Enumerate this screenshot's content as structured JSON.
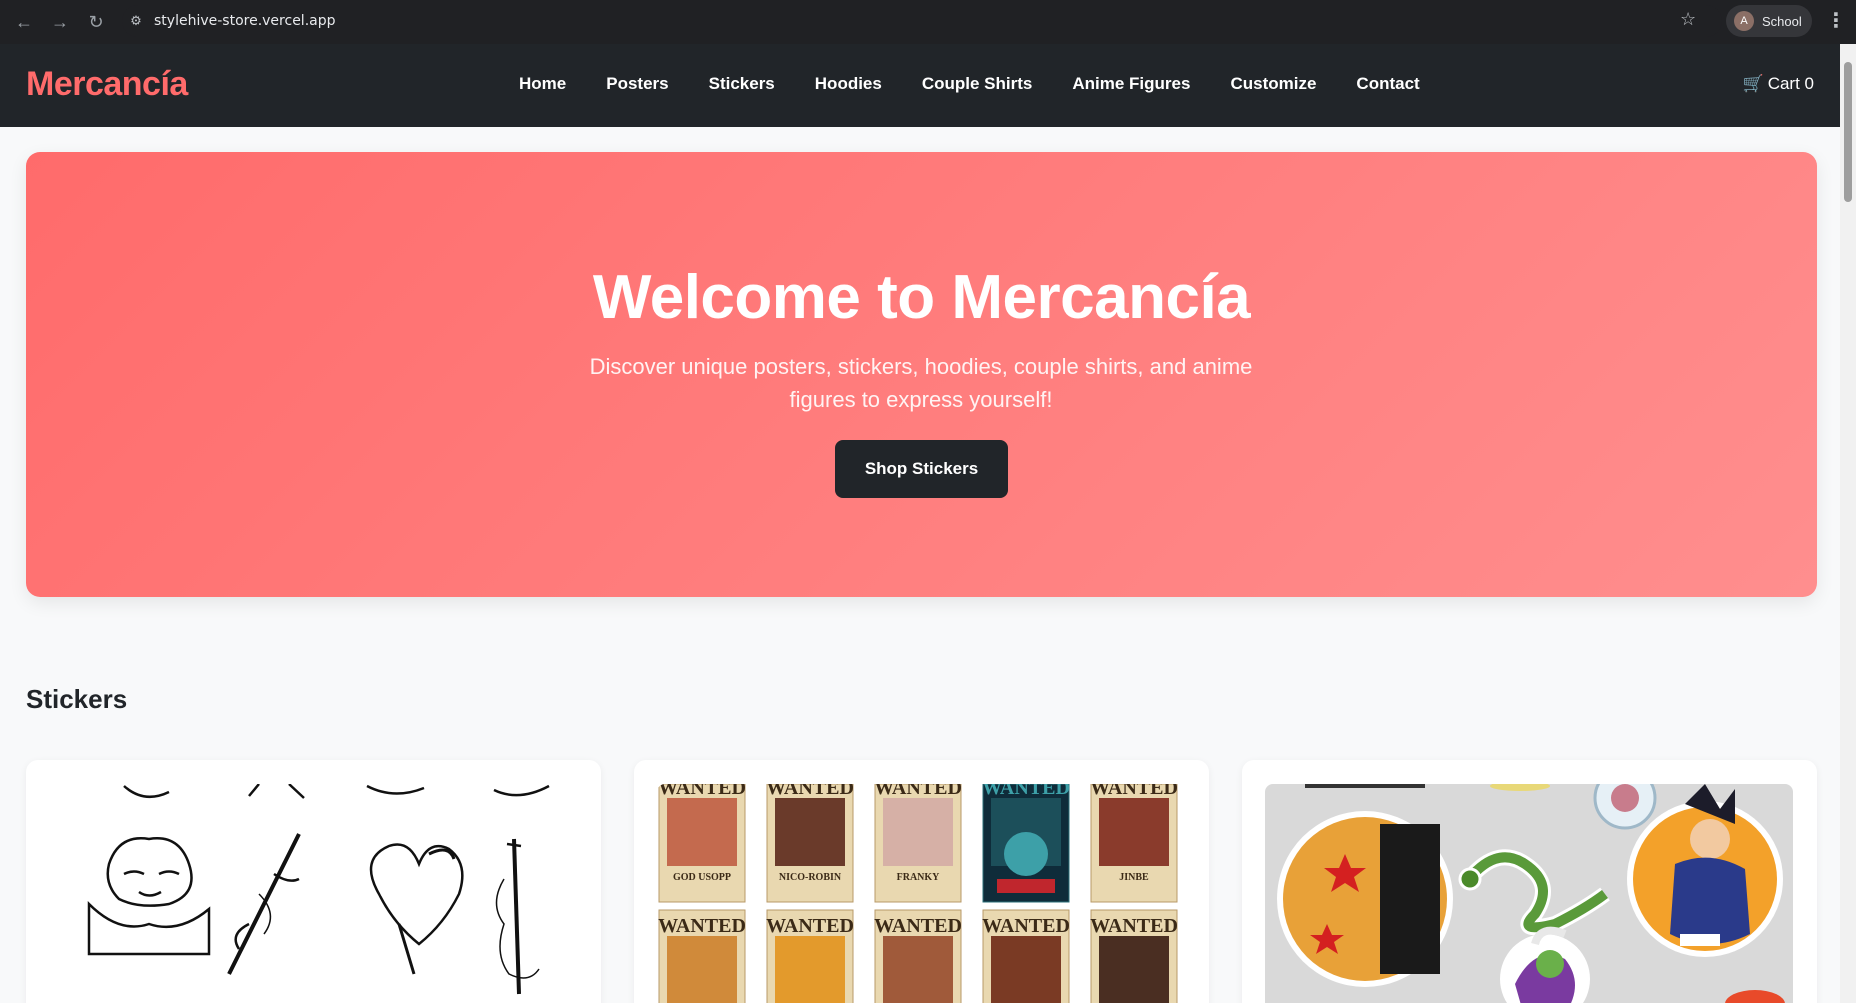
{
  "browser": {
    "url": "stylehive-store.vercel.app",
    "profile_initial": "A",
    "profile_name": "School"
  },
  "site": {
    "brand": "Mercancía",
    "brand_color": "#ff6b6b",
    "nav": [
      "Home",
      "Posters",
      "Stickers",
      "Hoodies",
      "Couple Shirts",
      "Anime Figures",
      "Customize",
      "Contact"
    ],
    "cart_icon": "🛒",
    "cart_label": "Cart 0"
  },
  "hero": {
    "title": "Welcome to Mercancía",
    "subtitle": "Discover unique posters, stickers, hoodies, couple shirts, and anime figures to express yourself!",
    "cta": "Shop Stickers"
  },
  "section": {
    "title": "Stickers",
    "wanted_labels": [
      "WANTED",
      "WANTED",
      "WANTED",
      "WANTED",
      "WANTED",
      "WANTED",
      "WANTED",
      "WANTED",
      "WANTED",
      "WANTED"
    ],
    "poster_captions": [
      "GOD USOPP",
      "NICO-ROBIN",
      "FRANKY",
      "",
      "JINBE"
    ]
  }
}
